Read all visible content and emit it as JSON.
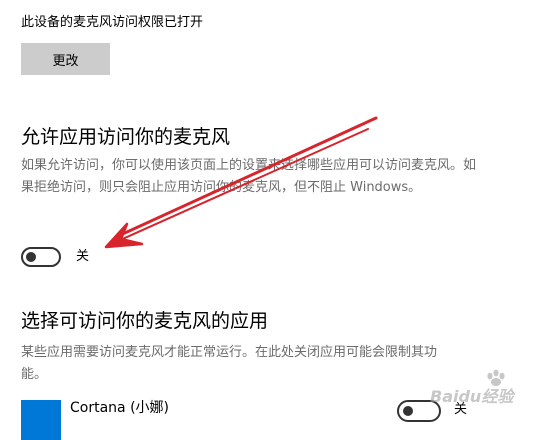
{
  "device_access": {
    "status_text": "此设备的麦克风访问权限已打开",
    "change_button_label": "更改"
  },
  "allow_apps": {
    "title": "允许应用访问你的麦克风",
    "description": "如果允许访问，你可以使用该页面上的设置来选择哪些应用可以访问麦克风。如果拒绝访问，则只会阻止应用访问你的麦克风，但不阻止 Windows。",
    "toggle_state": "关"
  },
  "choose_apps": {
    "title": "选择可访问你的麦克风的应用",
    "description": "某些应用需要访问麦克风才能正常运行。在此处关闭应用可能会限制其功能。",
    "apps": [
      {
        "name": "Cortana (小娜)",
        "toggle_state": "关",
        "icon_color": "#0078d7"
      }
    ]
  },
  "annotation": {
    "arrow_color": "#d8242b"
  },
  "watermark": {
    "text": "Baidu经验"
  }
}
